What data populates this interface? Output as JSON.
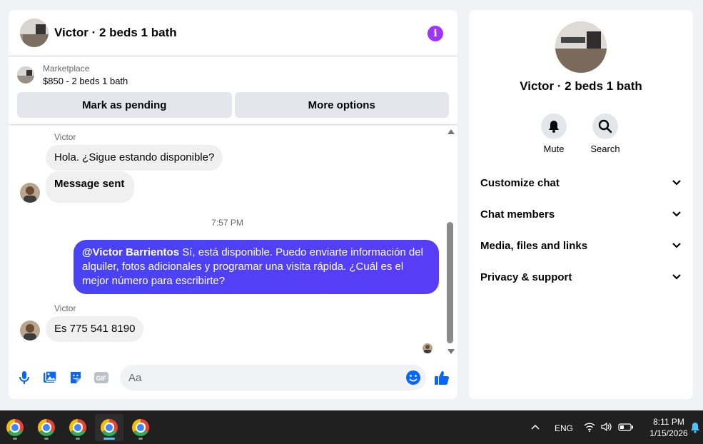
{
  "header": {
    "title": "Victor · 2 beds 1 bath"
  },
  "marketplace": {
    "label": "Marketplace",
    "listing": "$850 - 2 beds 1 bath",
    "pending_label": "Mark as pending",
    "more_label": "More options"
  },
  "messages": {
    "group1_sender": "Victor",
    "msg1": "Hola. ¿Sigue estando disponible?",
    "msg2": "Message sent",
    "timestamp": "7:57 PM",
    "out_mention": "@Victor Barrientos",
    "out_text": " Sí, está disponible. Puedo enviarte información del alquiler, fotos adicionales y programar una visita rápida. ¿Cuál es el mejor número para escribirte?",
    "group2_sender": "Victor",
    "msg3": "Es 775 541 8190"
  },
  "composer": {
    "placeholder": "Aa",
    "gif_label": "GIF"
  },
  "side": {
    "name": "Victor · 2 beds 1 bath",
    "mute_label": "Mute",
    "search_label": "Search",
    "sections": [
      "Customize chat",
      "Chat members",
      "Media, files and links",
      "Privacy & support"
    ]
  },
  "taskbar": {
    "lang": "ENG",
    "time": "8:11 PM",
    "date": "1/15/2026"
  },
  "colors": {
    "accent": "#0866ff",
    "outgoing": "#4744f5",
    "info": "#a033ff"
  }
}
